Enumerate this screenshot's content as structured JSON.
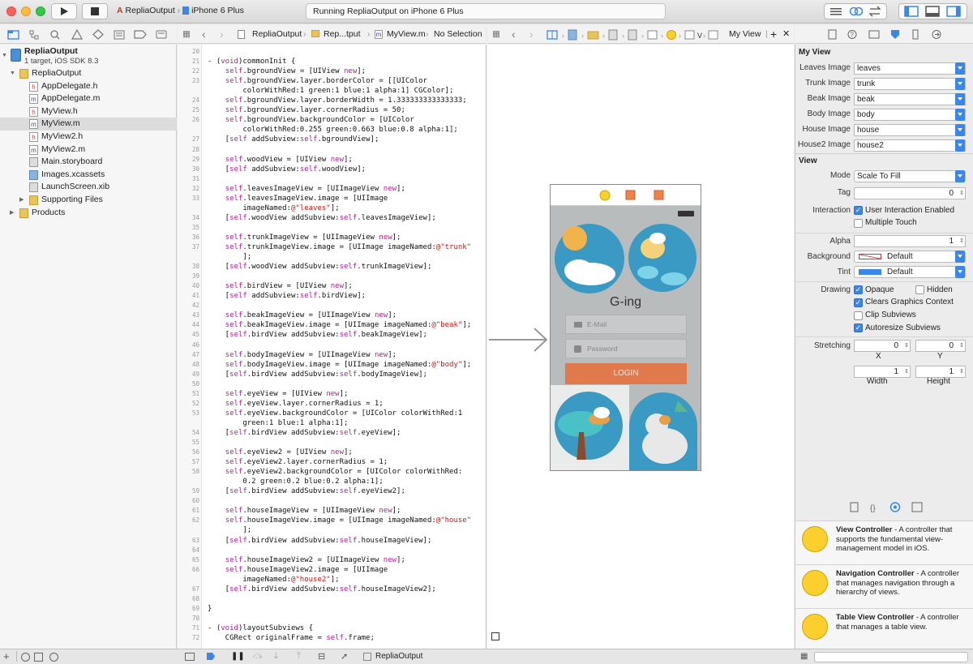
{
  "toolbar": {
    "scheme": "RepliaOutput",
    "device": "iPhone 6 Plus",
    "status": "Running RepliaOutput on iPhone 6 Plus"
  },
  "navigator": {
    "project": "RepliaOutput",
    "project_sub": "1 target, iOS SDK 8.3",
    "items": [
      {
        "label": "RepliaOutput",
        "kind": "folder",
        "indent": 1
      },
      {
        "label": "AppDelegate.h",
        "kind": "h",
        "indent": 2
      },
      {
        "label": "AppDelegate.m",
        "kind": "m",
        "indent": 2
      },
      {
        "label": "MyView.h",
        "kind": "h",
        "indent": 2
      },
      {
        "label": "MyView.m",
        "kind": "m",
        "indent": 2,
        "selected": true
      },
      {
        "label": "MyView2.h",
        "kind": "h",
        "indent": 2
      },
      {
        "label": "MyView2.m",
        "kind": "m",
        "indent": 2
      },
      {
        "label": "Main.storyboard",
        "kind": "s",
        "indent": 2
      },
      {
        "label": "Images.xcassets",
        "kind": "a",
        "indent": 2
      },
      {
        "label": "LaunchScreen.xib",
        "kind": "x",
        "indent": 2
      },
      {
        "label": "Supporting Files",
        "kind": "folder",
        "indent": 2
      },
      {
        "label": "Products",
        "kind": "folder",
        "indent": 1
      }
    ]
  },
  "jumpbar": {
    "crumbs": [
      "RepliaOutput",
      "Rep...tput",
      "MyView.m",
      "No Selection"
    ]
  },
  "jumpbar2": {
    "label": "My View"
  },
  "code": {
    "lines": [
      {
        "n": "20",
        "t": ""
      },
      {
        "n": "21",
        "t": "- (void)commonInit {"
      },
      {
        "n": "22",
        "t": "    self.bgroundView = [UIView new];"
      },
      {
        "n": "23",
        "t": "    self.bgroundView.layer.borderColor = [[UIColor"
      },
      {
        "n": "",
        "t": "        colorWithRed:1 green:1 blue:1 alpha:1] CGColor];"
      },
      {
        "n": "24",
        "t": "    self.bgroundView.layer.borderWidth = 1.333333333333333;"
      },
      {
        "n": "25",
        "t": "    self.bgroundView.layer.cornerRadius = 50;"
      },
      {
        "n": "26",
        "t": "    self.bgroundView.backgroundColor = [UIColor"
      },
      {
        "n": "",
        "t": "        colorWithRed:0.255 green:0.663 blue:0.8 alpha:1];"
      },
      {
        "n": "27",
        "t": "    [self addSubview:self.bgroundView];"
      },
      {
        "n": "28",
        "t": ""
      },
      {
        "n": "29",
        "t": "    self.woodView = [UIView new];"
      },
      {
        "n": "30",
        "t": "    [self addSubview:self.woodView];"
      },
      {
        "n": "31",
        "t": ""
      },
      {
        "n": "32",
        "t": "    self.leavesImageView = [UIImageView new];"
      },
      {
        "n": "33",
        "t": "    self.leavesImageView.image = [UIImage"
      },
      {
        "n": "",
        "t": "        imageNamed:@\"leaves\"];"
      },
      {
        "n": "34",
        "t": "    [self.woodView addSubview:self.leavesImageView];"
      },
      {
        "n": "35",
        "t": ""
      },
      {
        "n": "36",
        "t": "    self.trunkImageView = [UIImageView new];"
      },
      {
        "n": "37",
        "t": "    self.trunkImageView.image = [UIImage imageNamed:@\"trunk\""
      },
      {
        "n": "",
        "t": "        ];"
      },
      {
        "n": "38",
        "t": "    [self.woodView addSubview:self.trunkImageView];"
      },
      {
        "n": "39",
        "t": ""
      },
      {
        "n": "40",
        "t": "    self.birdView = [UIView new];"
      },
      {
        "n": "41",
        "t": "    [self addSubview:self.birdView];"
      },
      {
        "n": "42",
        "t": ""
      },
      {
        "n": "43",
        "t": "    self.beakImageView = [UIImageView new];"
      },
      {
        "n": "44",
        "t": "    self.beakImageView.image = [UIImage imageNamed:@\"beak\"];"
      },
      {
        "n": "45",
        "t": "    [self.birdView addSubview:self.beakImageView];"
      },
      {
        "n": "46",
        "t": ""
      },
      {
        "n": "47",
        "t": "    self.bodyImageView = [UIImageView new];"
      },
      {
        "n": "48",
        "t": "    self.bodyImageView.image = [UIImage imageNamed:@\"body\"];"
      },
      {
        "n": "49",
        "t": "    [self.birdView addSubview:self.bodyImageView];"
      },
      {
        "n": "50",
        "t": ""
      },
      {
        "n": "51",
        "t": "    self.eyeView = [UIView new];"
      },
      {
        "n": "52",
        "t": "    self.eyeView.layer.cornerRadius = 1;"
      },
      {
        "n": "53",
        "t": "    self.eyeView.backgroundColor = [UIColor colorWithRed:1"
      },
      {
        "n": "",
        "t": "        green:1 blue:1 alpha:1];"
      },
      {
        "n": "54",
        "t": "    [self.birdView addSubview:self.eyeView];"
      },
      {
        "n": "55",
        "t": ""
      },
      {
        "n": "56",
        "t": "    self.eyeView2 = [UIView new];"
      },
      {
        "n": "57",
        "t": "    self.eyeView2.layer.cornerRadius = 1;"
      },
      {
        "n": "58",
        "t": "    self.eyeView2.backgroundColor = [UIColor colorWithRed:"
      },
      {
        "n": "",
        "t": "        0.2 green:0.2 blue:0.2 alpha:1];"
      },
      {
        "n": "59",
        "t": "    [self.birdView addSubview:self.eyeView2];"
      },
      {
        "n": "60",
        "t": ""
      },
      {
        "n": "61",
        "t": "    self.houseImageView = [UIImageView new];"
      },
      {
        "n": "62",
        "t": "    self.houseImageView.image = [UIImage imageNamed:@\"house\""
      },
      {
        "n": "",
        "t": "        ];"
      },
      {
        "n": "63",
        "t": "    [self.birdView addSubview:self.houseImageView];"
      },
      {
        "n": "64",
        "t": ""
      },
      {
        "n": "65",
        "t": "    self.houseImageView2 = [UIImageView new];"
      },
      {
        "n": "66",
        "t": "    self.houseImageView2.image = [UIImage"
      },
      {
        "n": "",
        "t": "        imageNamed:@\"house2\"];"
      },
      {
        "n": "67",
        "t": "    [self.birdView addSubview:self.houseImageView2];"
      },
      {
        "n": "68",
        "t": ""
      },
      {
        "n": "69",
        "t": "}"
      },
      {
        "n": "70",
        "t": ""
      },
      {
        "n": "71",
        "t": "- (void)layoutSubviews {"
      },
      {
        "n": "72",
        "t": "    CGRect originalFrame = self.frame;"
      }
    ]
  },
  "phone": {
    "app_title": "G-ing",
    "email_placeholder": "E-Mail",
    "password_placeholder": "Password",
    "login_label": "LOGIN"
  },
  "inspector": {
    "section_title": "My View",
    "images": [
      {
        "label": "Leaves Image",
        "value": "leaves"
      },
      {
        "label": "Trunk Image",
        "value": "trunk"
      },
      {
        "label": "Beak Image",
        "value": "beak"
      },
      {
        "label": "Body Image",
        "value": "body"
      },
      {
        "label": "House Image",
        "value": "house"
      },
      {
        "label": "House2 Image",
        "value": "house2"
      }
    ],
    "view_title": "View",
    "mode_label": "Mode",
    "mode_value": "Scale To Fill",
    "tag_label": "Tag",
    "tag_value": "0",
    "interaction_label": "Interaction",
    "user_interaction": "User Interaction Enabled",
    "multiple_touch": "Multiple Touch",
    "alpha_label": "Alpha",
    "alpha_value": "1",
    "background_label": "Background",
    "background_value": "Default",
    "tint_label": "Tint",
    "tint_value": "Default",
    "drawing_label": "Drawing",
    "opaque": "Opaque",
    "hidden": "Hidden",
    "clears": "Clears Graphics Context",
    "clip": "Clip Subviews",
    "autoresize": "Autoresize Subviews",
    "stretching_label": "Stretching",
    "stretch_x": "0",
    "stretch_y": "0",
    "x_label": "X",
    "y_label": "Y",
    "stretch_w": "1",
    "stretch_h": "1",
    "width_label": "Width",
    "height_label": "Height"
  },
  "library": {
    "items": [
      {
        "title": "View Controller",
        "desc": " - A controller that supports the fundamental view-management model in iOS."
      },
      {
        "title": "Navigation Controller",
        "desc": " - A controller that manages navigation through a hierarchy of views."
      },
      {
        "title": "Table View Controller",
        "desc": " - A controller that manages a table view."
      }
    ]
  },
  "bottombar": {
    "target": "RepliaOutput"
  },
  "colors": {
    "accent": "#3b87e8",
    "login": "#e07a4d",
    "circle": "#3b9ac4",
    "selection": "#dcdcdc"
  }
}
